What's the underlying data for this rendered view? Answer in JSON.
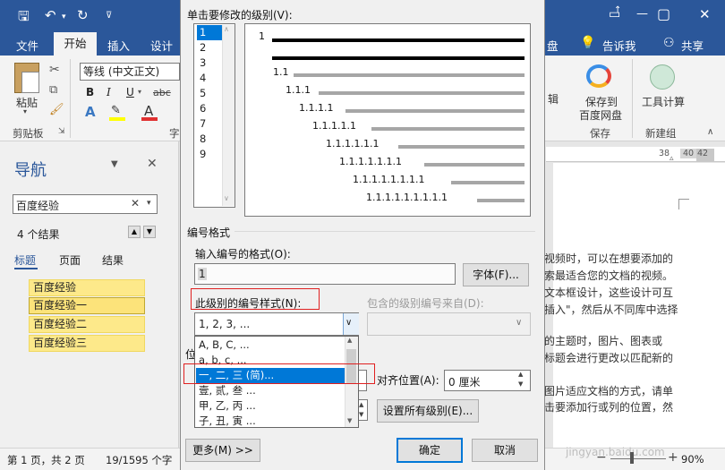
{
  "window": {
    "tabs": [
      "文件",
      "开始",
      "插入",
      "设计",
      "盘",
      "告诉我",
      "共享"
    ],
    "controls": {
      "minimize": "—",
      "restore": "▢",
      "close": "✕"
    }
  },
  "ribbon": {
    "paste": "粘贴",
    "clipboard_group": "剪贴板",
    "font_name": "等线 (中文正文)",
    "font_group_partial": "字",
    "edit_partial": "辑",
    "save_cloud_line1": "保存到",
    "save_cloud_line2": "百度网盘",
    "save_group": "保存",
    "tools": "工具计算",
    "new_group": "新建组"
  },
  "nav": {
    "title": "导航",
    "search_value": "百度经验",
    "result_count": "4 个结果",
    "tabs": [
      "标题",
      "页面",
      "结果"
    ],
    "items": [
      "百度经验",
      "百度经验一",
      "百度经验二",
      "百度经验三"
    ]
  },
  "ruler": {
    "left_label": "38",
    "mid": "40",
    "right_label": "42"
  },
  "document": {
    "lines": [
      "视频时，可以在想要添加的",
      "索最适合您的文档的视频。",
      "文本框设计，这些设计可互",
      "插入\"，然后从不同库中选择",
      "的主题时，图片、图表或",
      "标题会进行更改以匹配新的",
      "图片适应文档的方式，请单",
      "击要添加行或列的位置，然"
    ]
  },
  "status": {
    "page": "第 1 页，共 2 页",
    "words": "19/1595 个字",
    "zoom": "90%",
    "watermark": "jingyan.baidu.com"
  },
  "dialog": {
    "level_label": "单击要修改的级别(V):",
    "levels": [
      "1",
      "2",
      "3",
      "4",
      "5",
      "6",
      "7",
      "8",
      "9"
    ],
    "selected_level": "1",
    "preview_labels": [
      "1",
      "1.1",
      "1.1.1",
      "1.1.1.1",
      "1.1.1.1.1",
      "1.1.1.1.1.1",
      "1.1.1.1.1.1.1",
      "1.1.1.1.1.1.1.1",
      "1.1.1.1.1.1.1.1.1"
    ],
    "section_numbering": "编号格式",
    "format_label": "输入编号的格式(O):",
    "format_value": "1",
    "font_button": "字体(F)...",
    "style_label": "此级别的编号样式(N):",
    "include_label": "包含的级别编号来自(D):",
    "style_value": "1, 2, 3, ...",
    "style_options": [
      "A, B, C, ...",
      "a, b, c, ...",
      "一, 二, 三 (简)...",
      "壹, 贰, 叁 ...",
      "甲, 乙, 丙 ...",
      "子, 丑, 寅 ..."
    ],
    "selected_option_index": 2,
    "position_partial": "位",
    "align_label": "对齐位置(A):",
    "align_value": "0 厘米",
    "set_all_button": "设置所有级别(E)...",
    "more_button": "更多(M) >>",
    "ok_button": "确定",
    "cancel_button": "取消"
  },
  "colors": {
    "accent": "#2b579a",
    "highlight": "#fde98a",
    "selection": "#0078d7",
    "annotation": "#e02020"
  }
}
